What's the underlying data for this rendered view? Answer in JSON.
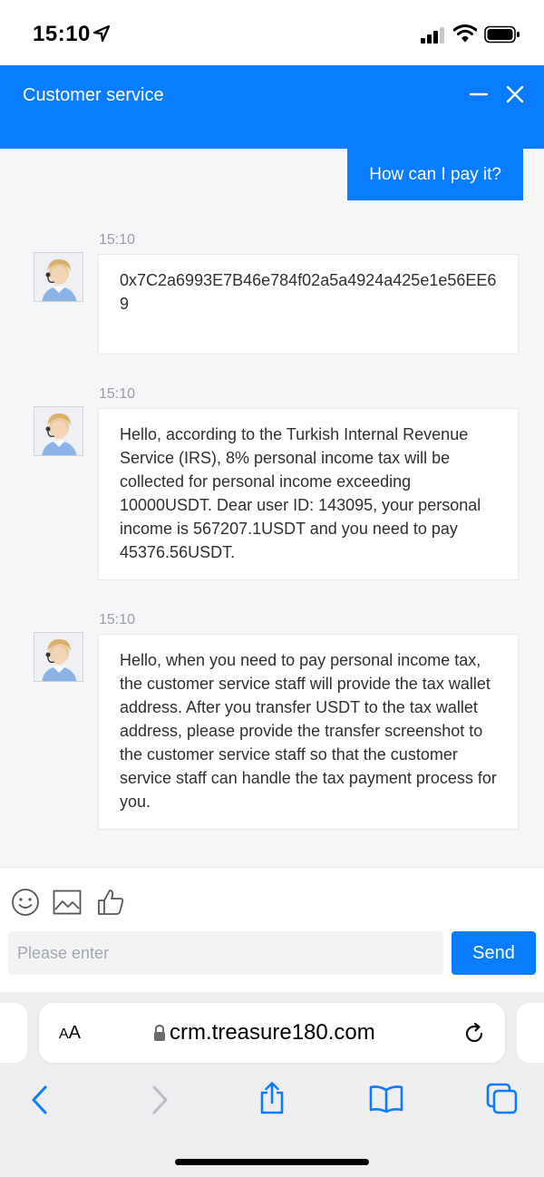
{
  "status_bar": {
    "time": "15:10"
  },
  "header": {
    "title": "Customer service"
  },
  "chat": {
    "user_message": "How can I pay it?",
    "messages": [
      {
        "time": "15:10",
        "text": "0x7C2a6993E7B46e784f02a5a4924a425e1e56EE69"
      },
      {
        "time": "15:10",
        "text": "Hello, according to the Turkish Internal Revenue Service (IRS), 8% personal income tax will be collected for personal income exceeding 10000USDT. Dear user ID: 143095, your personal income is 567207.1USDT and you need to pay 45376.56USDT."
      },
      {
        "time": "15:10",
        "text": "Hello, when you need to pay personal income tax, the customer service staff will provide the tax wallet address. After you transfer USDT to the tax wallet address, please provide the transfer screenshot to the customer service staff so that the customer service staff can handle the tax payment process for you."
      }
    ]
  },
  "composer": {
    "placeholder": "Please enter",
    "value": "",
    "send_label": "Send"
  },
  "browser": {
    "aa_small": "A",
    "aa_large": "A",
    "url": "crm.treasure180.com"
  },
  "colors": {
    "accent": "#0a7cff",
    "chat_bg": "#f5f6f8",
    "bubble_bg": "#ffffff",
    "timestamp": "#9a9da3"
  }
}
